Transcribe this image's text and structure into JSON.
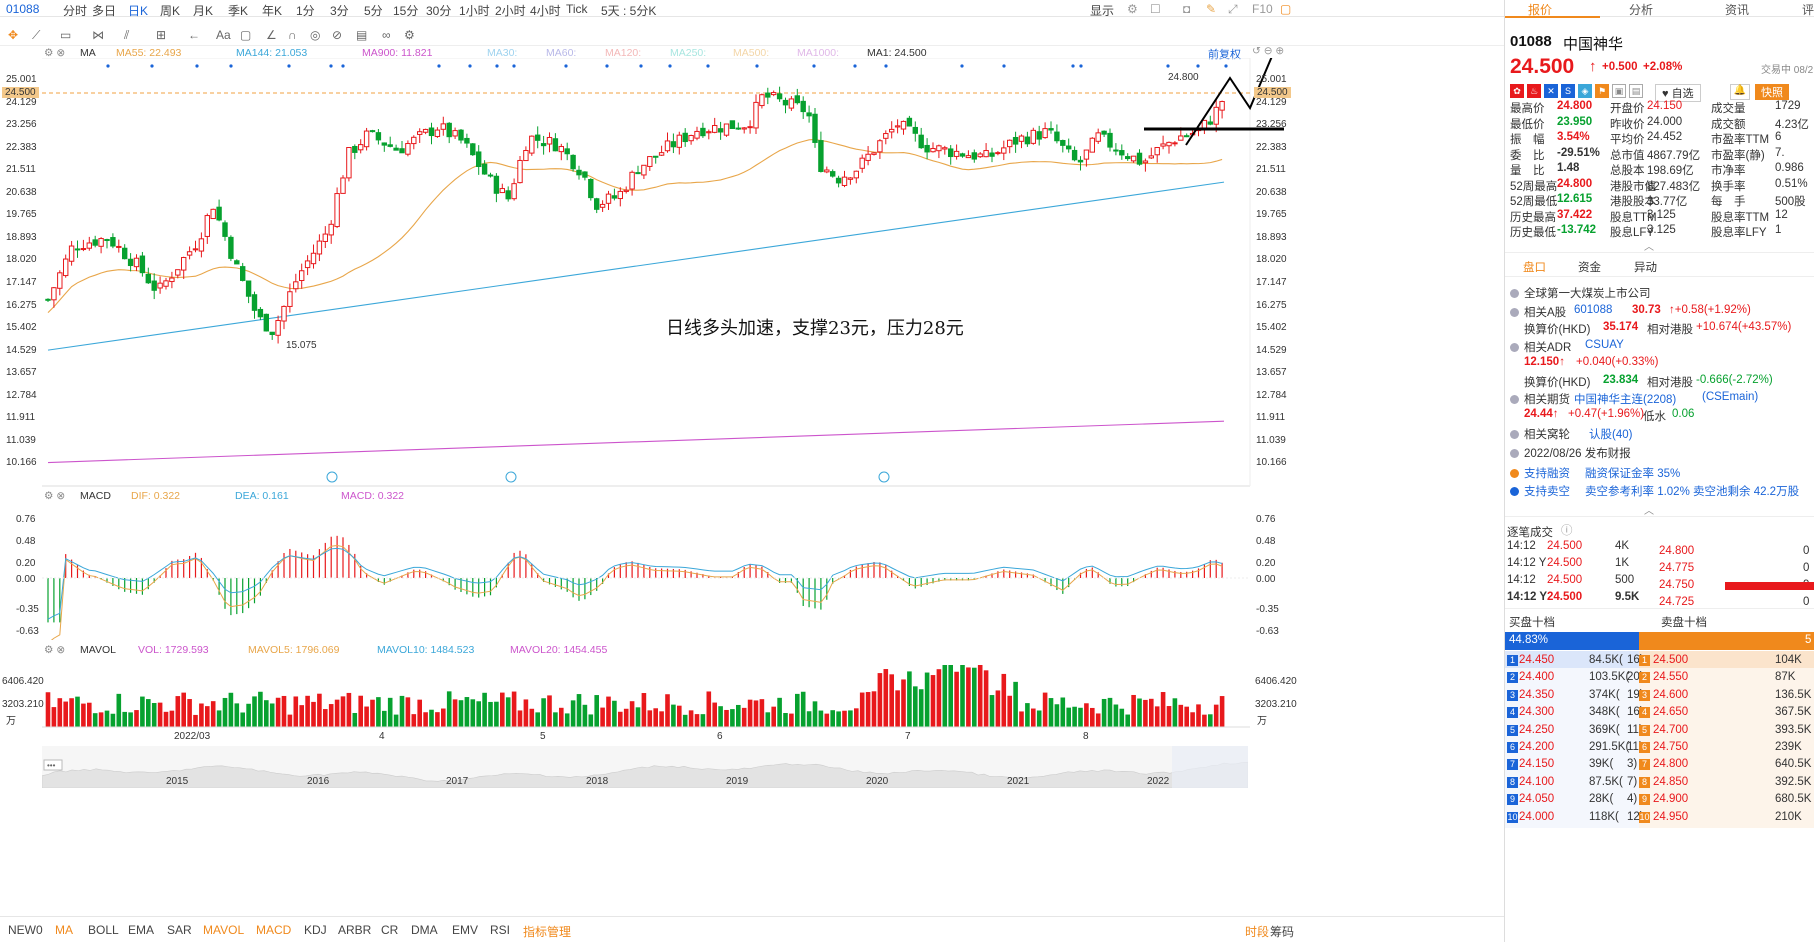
{
  "topbar": {
    "code": "01088",
    "items": [
      "分时",
      "多日",
      "日K",
      "周K",
      "月K",
      "季K",
      "年K",
      "1分",
      "3分",
      "5分",
      "15分",
      "30分",
      "1小时",
      "2小时",
      "4小时",
      "Tick",
      "5天 : 5分K"
    ],
    "active": "日K",
    "right": [
      "显示",
      "F10"
    ]
  },
  "toolbar": {
    "icons": [
      "crosshair-icon",
      "line-icon",
      "rect-icon",
      "fan-icon",
      "parallel-icon",
      "arrow-icon",
      "level-icon",
      "text-icon",
      "note-icon",
      "angle-icon",
      "magnet-icon",
      "eye-icon",
      "delete-icon",
      "link-icon",
      "settings-icon"
    ],
    "text_tool": "Aa"
  },
  "main_legend": {
    "name": "MA",
    "ma55": "MA55: 22.493",
    "ma144": "MA144: 21.053",
    "ma900": "MA900: 11.821",
    "ma30": "MA30:",
    "ma60": "MA60:",
    "ma120": "MA120:",
    "ma250": "MA250:",
    "ma500": "MA500:",
    "ma1000": "MA1000:",
    "ma1": "MA1: 24.500",
    "adjust": "前复权"
  },
  "annotation": "日线多头加速，支撑23元，压力28元",
  "price_axis": {
    "labels": [
      "25.001",
      "24.129",
      "23.256",
      "22.383",
      "21.511",
      "20.638",
      "19.765",
      "18.893",
      "18.020",
      "17.147",
      "16.275",
      "15.402",
      "14.529",
      "13.657",
      "12.784",
      "11.911",
      "11.039",
      "10.166"
    ],
    "current": "24.500",
    "high_mark": "24.800",
    "low_mark": "15.075"
  },
  "macd_legend": {
    "name": "MACD",
    "dif": "DIF: 0.322",
    "dea": "DEA: 0.161",
    "macd": "MACD: 0.322"
  },
  "macd_axis": [
    "0.76",
    "0.48",
    "0.20",
    "0.00",
    "-0.35",
    "-0.63"
  ],
  "vol_legend": {
    "name": "MAVOL",
    "vol": "VOL: 1729.593",
    "ma5": "MAVOL5: 1796.069",
    "ma10": "MAVOL10: 1484.523",
    "ma20": "MAVOL20: 1454.455"
  },
  "vol_axis": [
    "6406.420",
    "3203.210",
    "万"
  ],
  "date_axis": [
    "2022/03",
    "4",
    "5",
    "6",
    "7",
    "8"
  ],
  "overview_years": [
    "2015",
    "2016",
    "2017",
    "2018",
    "2019",
    "2020",
    "2021",
    "2022"
  ],
  "bottom_tabs": [
    "NEW0",
    "MA",
    "BOLL",
    "EMA",
    "SAR",
    "MAVOL",
    "MACD",
    "KDJ",
    "ARBR",
    "CR",
    "DMA",
    "EMV",
    "RSI",
    "指标管理"
  ],
  "bottom_active": [
    "MA",
    "MAVOL",
    "MACD",
    "指标管理"
  ],
  "bottom_right": [
    "时段",
    "筹码"
  ],
  "right_panel": {
    "tabs": [
      "报价",
      "分析",
      "资讯",
      "评"
    ],
    "code": "01088",
    "name": "中国神华",
    "price": "24.500",
    "change": "+0.500",
    "pct": "+2.08%",
    "trade_date": "交易中 08/2",
    "tags": [
      "自选",
      "快照"
    ],
    "stats": [
      [
        "最高价",
        "24.800",
        "开盘价",
        "24.150",
        "成交量",
        "1729"
      ],
      [
        "最低价",
        "23.950",
        "昨收价",
        "24.000",
        "成交额",
        "4.23亿"
      ],
      [
        "振　幅",
        "3.54%",
        "平均价",
        "24.452",
        "市盈率TTM",
        "6"
      ],
      [
        "委　比",
        "-29.51%",
        "总市值",
        "4867.79亿",
        "市盈率(静)",
        "7."
      ],
      [
        "量　比",
        "1.48",
        "总股本",
        "198.69亿",
        "市净率",
        "0.986"
      ],
      [
        "52周最高",
        "24.800",
        "港股市值",
        "827.483亿",
        "换手率",
        "0.51%"
      ],
      [
        "52周最低",
        "12.615",
        "港股股本",
        "33.77亿",
        "每　手",
        "500股"
      ],
      [
        "历史最高",
        "37.422",
        "股息TTM",
        "3.125",
        "股息率TTM",
        "12"
      ],
      [
        "历史最低",
        "-13.742",
        "股息LFY",
        "3.125",
        "股息率LFY",
        "1"
      ]
    ],
    "subtabs": [
      "盘口",
      "资金",
      "异动"
    ],
    "info": {
      "desc": "全球第一大煤炭上市公司",
      "a_label": "相关A股",
      "a_code": "601088",
      "a_price": "30.73",
      "a_chg": "+0.58(+1.92%)",
      "a_conv_label": "换算价(HKD)",
      "a_conv": "35.174",
      "a_prem_label": "相对港股",
      "a_prem": "+10.674(+43.57%)",
      "adr_label": "相关ADR",
      "adr_code": "CSUAY",
      "adr_price": "12.150",
      "adr_chg": "+0.040(+0.33%)",
      "adr_conv_label": "换算价(HKD)",
      "adr_conv": "23.834",
      "adr_prem_label": "相对港股",
      "adr_prem": "-0.666(-2.72%)",
      "fut_label": "相关期货",
      "fut_name": "中国神华主连(2208)",
      "fut_code": "(CSEmain)",
      "fut_price": "24.44",
      "fut_chg": "+0.47(+1.96%)",
      "fut_basis_label": "低水",
      "fut_basis": "0.06",
      "warrant_label": "相关窝轮",
      "warrant": "认股(40)",
      "report": "2022/08/26  发布财报",
      "margin": "支持融资",
      "margin_rate": "融资保证金率 35%",
      "short": "支持卖空",
      "short_info": "卖空参考利率 1.02%  卖空池剩余 42.2万股"
    },
    "ticks_title": "逐笔成交",
    "ticks": [
      [
        "14:12",
        "24.500",
        "4K"
      ],
      [
        "14:12 Y",
        "24.500",
        "1K"
      ],
      [
        "14:12",
        "24.500",
        "500"
      ],
      [
        "14:12 Y",
        "24.500",
        "9.5K"
      ]
    ],
    "mini_book": [
      [
        "24.800",
        "0"
      ],
      [
        "24.775",
        "0"
      ],
      [
        "24.750",
        "9"
      ],
      [
        "24.725",
        "0"
      ]
    ],
    "book_titles": [
      "买盘十档",
      "卖盘十档"
    ],
    "bid_pct": "44.83%",
    "ask_pct": "5",
    "book": [
      [
        "1",
        "24.450",
        "84.5K(",
        "16)",
        "24.500",
        "104K"
      ],
      [
        "2",
        "24.400",
        "103.5K(",
        "20)",
        "24.550",
        "87K"
      ],
      [
        "3",
        "24.350",
        "374K(",
        "19)",
        "24.600",
        "136.5K"
      ],
      [
        "4",
        "24.300",
        "348K(",
        "16)",
        "24.650",
        "367.5K"
      ],
      [
        "5",
        "24.250",
        "369K(",
        "11)",
        "24.700",
        "393.5K"
      ],
      [
        "6",
        "24.200",
        "291.5K(",
        "11)",
        "24.750",
        "239K"
      ],
      [
        "7",
        "24.150",
        "39K(",
        "3)",
        "24.800",
        "640.5K"
      ],
      [
        "8",
        "24.100",
        "87.5K(",
        "7)",
        "24.850",
        "392.5K"
      ],
      [
        "9",
        "24.050",
        "28K(",
        "4)",
        "24.900",
        "680.5K"
      ],
      [
        "10",
        "24.000",
        "118K(",
        "12)",
        "24.950",
        "210K"
      ]
    ]
  },
  "colors": {
    "up": "#e8191c",
    "down": "#07a12f",
    "ma55": "#e8a64a",
    "ma144": "#3ba7d9",
    "ma900": "#cc55cc",
    "dif": "#3ba7d9",
    "dea": "#e8a64a",
    "accent": "#1a64d8",
    "bid": "#1a64d8",
    "ask": "#f0891c"
  }
}
